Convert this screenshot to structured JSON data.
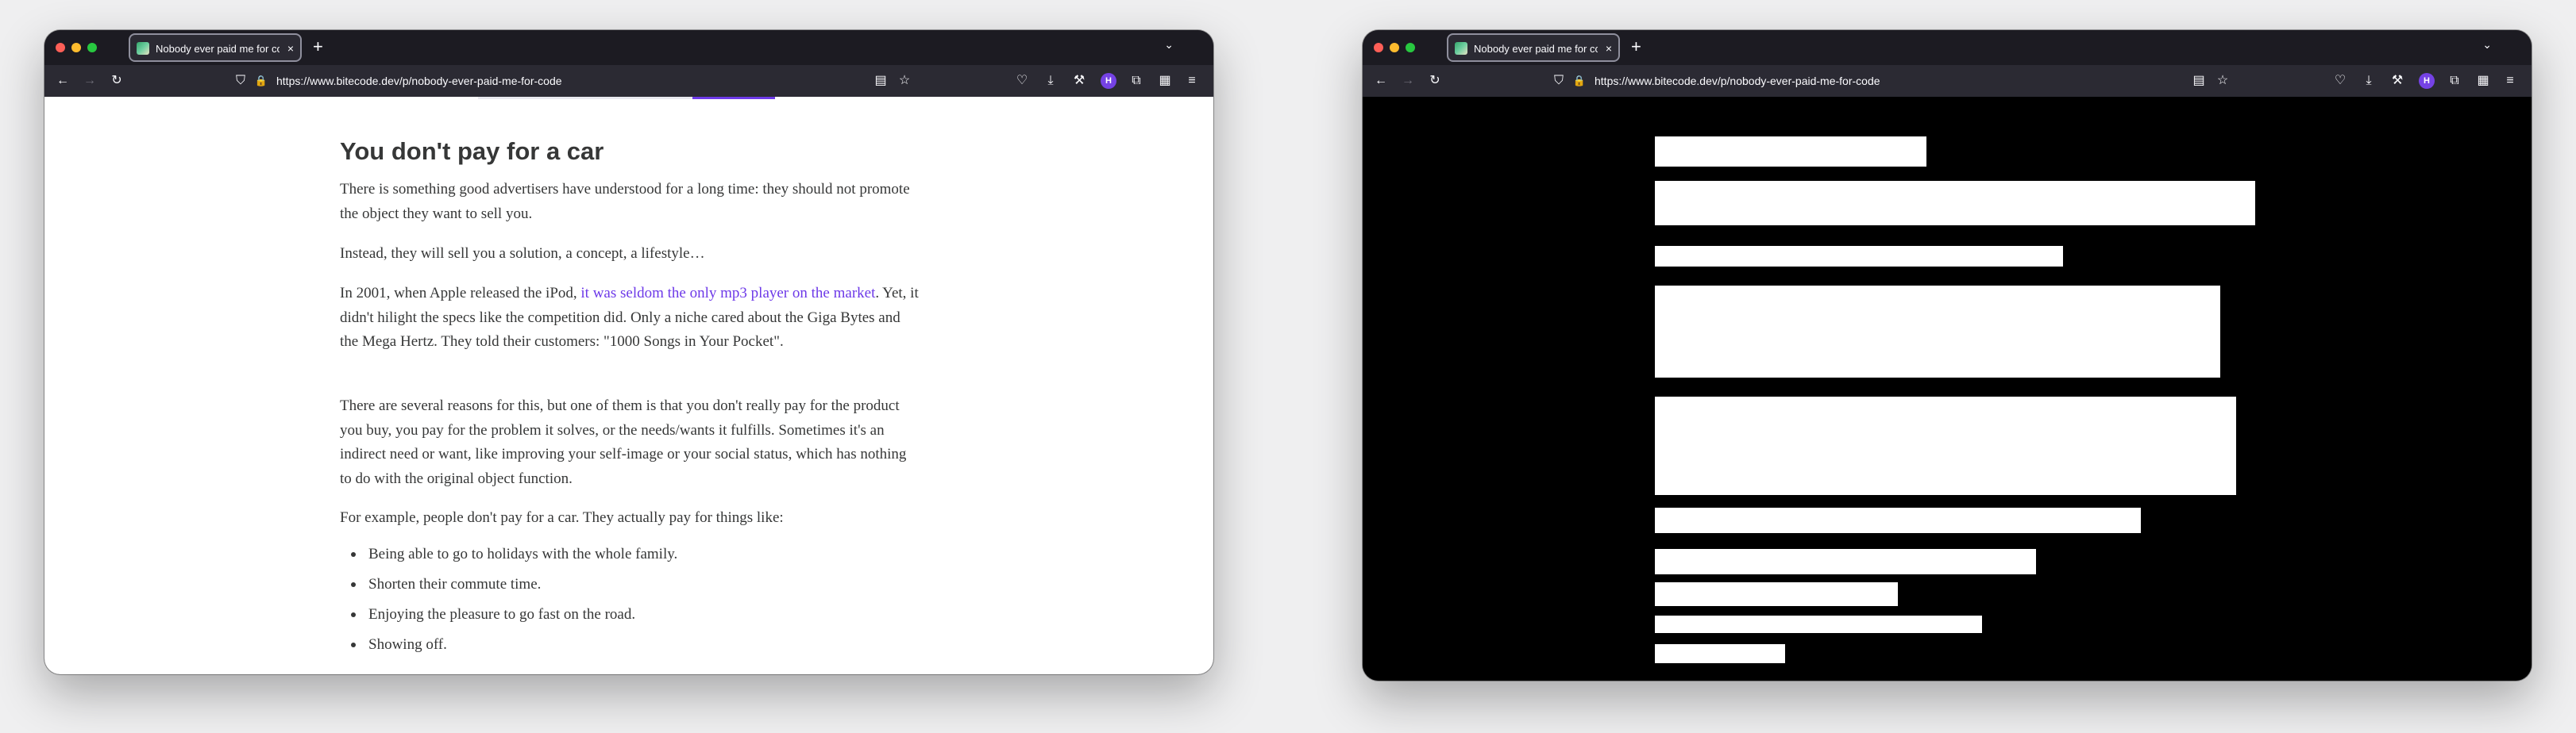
{
  "browser": {
    "tab_title": "Nobody ever paid me for code",
    "tab_close": "×",
    "new_tab": "+",
    "list_tabs": "⌄",
    "url": "https://www.bitecode.dev/p/nobody-ever-paid-me-for-code",
    "account_initial": "H",
    "icons": {
      "back": "←",
      "forward": "→",
      "reload": "↻",
      "shield": "⛉",
      "lock": "🔒",
      "reader": "▤",
      "bookmark": "☆",
      "pocket": "♡",
      "downloads": "⤓",
      "tools": "⚒",
      "extensions": "⧉",
      "grid": "▦",
      "menu": "≡"
    },
    "colors": {
      "toolbar": "#2b2a33",
      "tabstrip": "#1c1b22",
      "accent": "#6d39e8"
    }
  },
  "article": {
    "heading": "You don't pay for a car",
    "p1": "There is something good advertisers have understood for a long time: they should not promote the object they want to sell you.",
    "p2": "Instead, they will sell you a solution, a concept, a lifestyle…",
    "p3_before": "In 2001, when Apple released the iPod, ",
    "p3_link": "it was seldom the only mp3 player on the market",
    "p3_after": ". Yet, it didn't hilight the specs like the competition did. Only a niche cared about the Giga Bytes and the Mega Hertz. They told their customers: \"1000 Songs in Your Pocket\".",
    "p4": "There are several reasons for this, but one of them is that you don't really pay for the product you buy, you pay for the problem it solves, or the needs/wants it fulfills. Sometimes it's an indirect need or want, like improving your self-image or your social status, which has nothing to do with the original object function.",
    "p5": "For example, people don't pay for a car. They actually pay for things like:",
    "bullets": [
      "Being able to go to holidays with the whole family.",
      "Shorten their commute time.",
      "Enjoying the pleasure to go fast on the road.",
      "Showing off."
    ]
  }
}
